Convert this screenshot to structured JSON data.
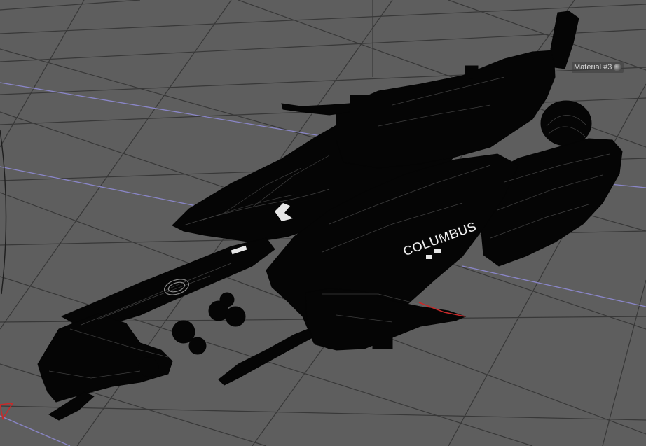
{
  "viewport": {
    "background_color": "#5e5e5e",
    "grid_color": "#383838",
    "axis_color": "#8a86c8",
    "model_color": "#050505",
    "highlight_color": "#e6e6e6",
    "gizmo_color": "#c82a2a"
  },
  "model": {
    "hull_text": "COLUMBUS"
  },
  "material_tag": {
    "label": "Material #3",
    "icon": "material-sphere-icon"
  }
}
